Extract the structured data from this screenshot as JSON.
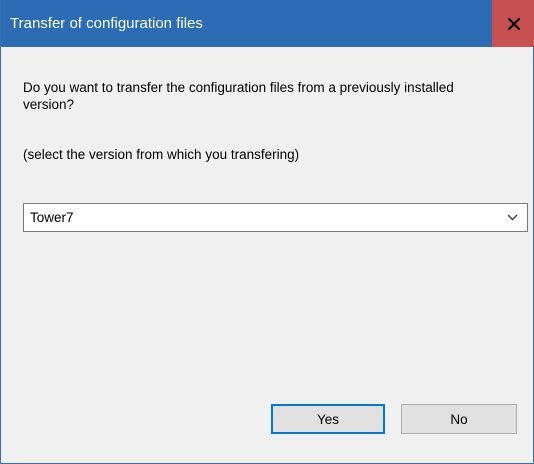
{
  "window": {
    "title": "Transfer of configuration files",
    "close_icon": "close-icon"
  },
  "dialog": {
    "question": "Do you want to transfer the configuration files from a previously installed version?",
    "hint": "(select the version from which you transfering)",
    "version_select": {
      "selected": "Tower7",
      "arrow_icon": "chevron-down-icon"
    },
    "buttons": {
      "yes": "Yes",
      "no": "No"
    }
  },
  "colors": {
    "titlebar": "#2c6cb5",
    "close_button": "#c75050",
    "default_button_border": "#0078d7",
    "background": "#f0f0f0"
  }
}
